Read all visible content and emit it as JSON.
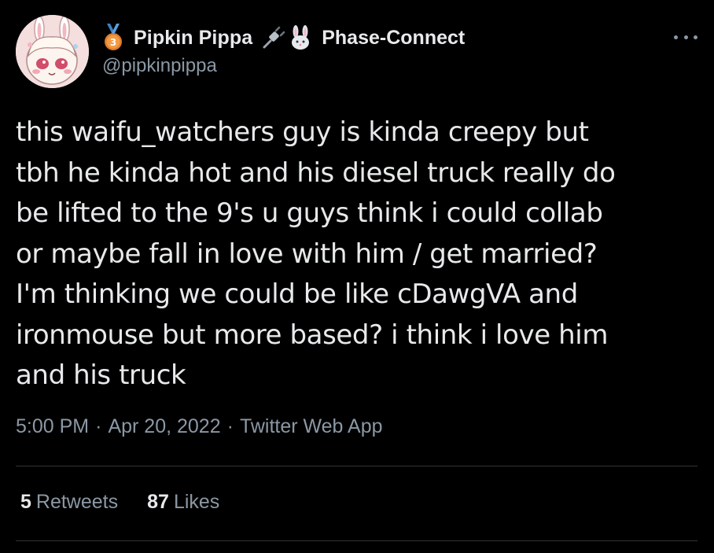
{
  "author": {
    "display_name": "Pipkin Pippa",
    "affiliation": "Phase-Connect",
    "handle": "@pipkinpippa",
    "badge_number": "3",
    "icons": [
      "medal-icon",
      "plug-icon",
      "bunny-icon",
      "avatar"
    ]
  },
  "tweet": {
    "text": "this waifu_watchers guy is kinda creepy but\ntbh he kinda hot and his diesel truck really do\nbe lifted to the 9's u guys think i could collab\nor maybe fall in love with him / get married?\nI'm thinking we could be like cDawgVA and\nironmouse but more based? i think i love him\nand his truck"
  },
  "meta": {
    "time": "5:00 PM",
    "date": "Apr 20, 2022",
    "source": "Twitter Web App",
    "separator": "·"
  },
  "stats": {
    "retweets_count": "5",
    "retweets_label": "Retweets",
    "likes_count": "87",
    "likes_label": "Likes"
  },
  "colors": {
    "background": "#000000",
    "primary_text": "#e7e9ea",
    "secondary_text": "#8b98a5",
    "divider": "#2f3336",
    "medal": "#e07c2a"
  }
}
